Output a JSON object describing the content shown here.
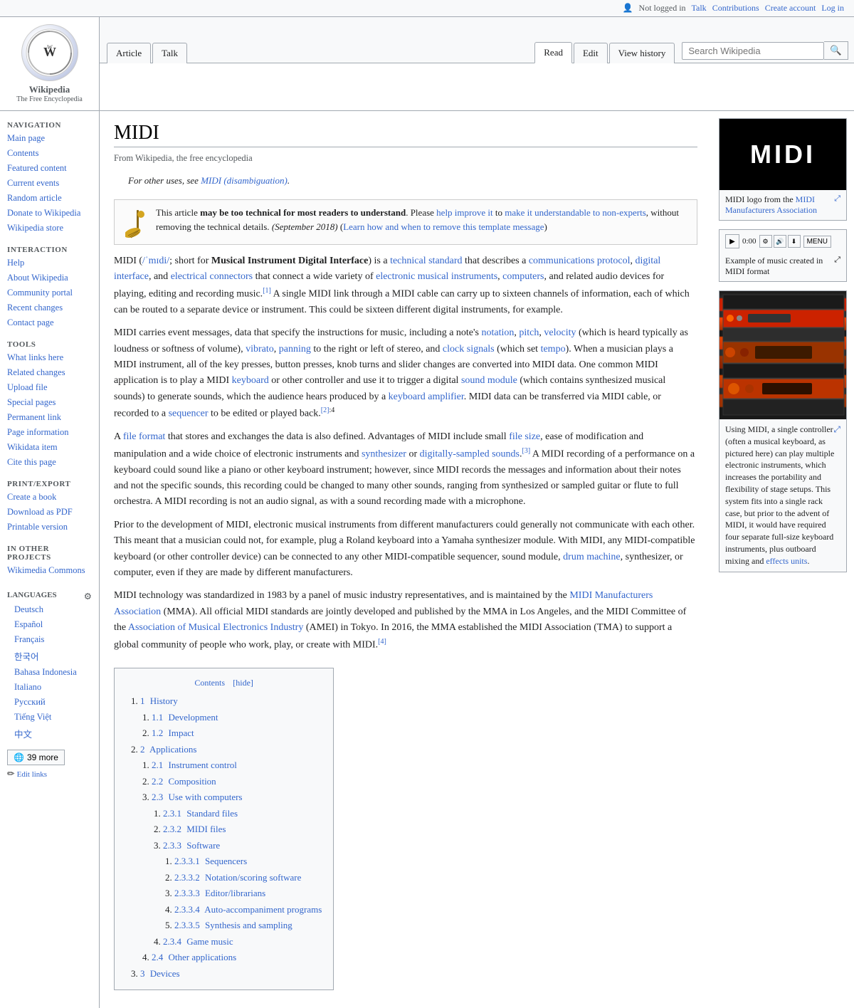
{
  "topbar": {
    "not_logged_in": "Not logged in",
    "talk": "Talk",
    "contributions": "Contributions",
    "create_account": "Create account",
    "log_in": "Log in"
  },
  "logo": {
    "title": "Wikipedia",
    "subtitle": "The Free Encyclopedia"
  },
  "tabs": [
    {
      "label": "Article",
      "id": "article",
      "active": false
    },
    {
      "label": "Talk",
      "id": "talk",
      "active": false
    },
    {
      "label": "Read",
      "id": "read",
      "active": true
    },
    {
      "label": "Edit",
      "id": "edit",
      "active": false
    },
    {
      "label": "View history",
      "id": "view-history",
      "active": false
    }
  ],
  "search": {
    "placeholder": "Search Wikipedia"
  },
  "sidebar": {
    "navigation_title": "Navigation",
    "nav_items": [
      {
        "label": "Main page",
        "id": "main-page"
      },
      {
        "label": "Contents",
        "id": "contents"
      },
      {
        "label": "Featured content",
        "id": "featured-content"
      },
      {
        "label": "Current events",
        "id": "current-events"
      },
      {
        "label": "Random article",
        "id": "random-article"
      },
      {
        "label": "Donate to Wikipedia",
        "id": "donate"
      },
      {
        "label": "Wikipedia store",
        "id": "store"
      }
    ],
    "interaction_title": "Interaction",
    "interaction_items": [
      {
        "label": "Help",
        "id": "help"
      },
      {
        "label": "About Wikipedia",
        "id": "about"
      },
      {
        "label": "Community portal",
        "id": "community-portal"
      },
      {
        "label": "Recent changes",
        "id": "recent-changes"
      },
      {
        "label": "Contact page",
        "id": "contact"
      }
    ],
    "tools_title": "Tools",
    "tools_items": [
      {
        "label": "What links here",
        "id": "what-links"
      },
      {
        "label": "Related changes",
        "id": "related-changes"
      },
      {
        "label": "Upload file",
        "id": "upload-file"
      },
      {
        "label": "Special pages",
        "id": "special-pages"
      },
      {
        "label": "Permanent link",
        "id": "permanent-link"
      },
      {
        "label": "Page information",
        "id": "page-info"
      },
      {
        "label": "Wikidata item",
        "id": "wikidata"
      },
      {
        "label": "Cite this page",
        "id": "cite"
      }
    ],
    "print_title": "Print/export",
    "print_items": [
      {
        "label": "Create a book",
        "id": "create-book"
      },
      {
        "label": "Download as PDF",
        "id": "download-pdf"
      },
      {
        "label": "Printable version",
        "id": "printable"
      }
    ],
    "other_title": "In other projects",
    "other_items": [
      {
        "label": "Wikimedia Commons",
        "id": "wikimedia-commons"
      }
    ],
    "languages_title": "Languages",
    "language_items": [
      {
        "label": "Deutsch",
        "id": "deutsch"
      },
      {
        "label": "Español",
        "id": "espanol"
      },
      {
        "label": "Français",
        "id": "francais"
      },
      {
        "label": "한국어",
        "id": "korean"
      },
      {
        "label": "Bahasa Indonesia",
        "id": "bahasa-indonesia"
      },
      {
        "label": "Italiano",
        "id": "italiano"
      },
      {
        "label": "Русский",
        "id": "russian"
      },
      {
        "label": "Tiếng Việt",
        "id": "tieng-viet"
      },
      {
        "label": "中文",
        "id": "chinese"
      }
    ],
    "more_languages": "39 more",
    "edit_links": "Edit links"
  },
  "page": {
    "title": "MIDI",
    "from_wiki": "From Wikipedia, the free encyclopedia",
    "hatnote": "For other uses, see MIDI (disambiguation).",
    "hatnote_link": "MIDI (disambiguation)",
    "ambox_text_bold": "This article may be too technical for most readers to understand.",
    "ambox_text": "Please help improve it to make it understandable to non-experts, without removing the technical details.",
    "ambox_date": "(September 2018)",
    "ambox_link_text": "help improve it",
    "ambox_link2_text": "make it understandable to non-experts",
    "ambox_link3_text": "Learn how and when to remove this template message"
  },
  "article": {
    "intro_p1": "MIDI (/ˈmɪdi/; short for Musical Instrument Digital Interface) is a technical standard that describes a communications protocol, digital interface, and electrical connectors that connect a wide variety of electronic musical instruments, computers, and related audio devices for playing, editing and recording music.[1] A single MIDI link through a MIDI cable can carry up to sixteen channels of information, each of which can be routed to a separate device or instrument. This could be sixteen different digital instruments, for example.",
    "intro_p2": "MIDI carries event messages, data that specify the instructions for music, including a note's notation, pitch, velocity (which is heard typically as loudness or softness of volume), vibrato, panning to the right or left of stereo, and clock signals (which set tempo). When a musician plays a MIDI instrument, all of the key presses, button presses, knob turns and slider changes are converted into MIDI data. One common MIDI application is to play a MIDI keyboard or other controller and use it to trigger a digital sound module (which contains synthesized musical sounds) to generate sounds, which the audience hears produced by a keyboard amplifier. MIDI data can be transferred via MIDI cable, or recorded to a sequencer to be edited or played back.[2]:4",
    "intro_p3": "A file format that stores and exchanges the data is also defined. Advantages of MIDI include small file size, ease of modification and manipulation and a wide choice of electronic instruments and synthesizer or digitally-sampled sounds.[3] A MIDI recording of a performance on a keyboard could sound like a piano or other keyboard instrument; however, since MIDI records the messages and information about their notes and not the specific sounds, this recording could be changed to many other sounds, ranging from synthesized or sampled guitar or flute to full orchestra. A MIDI recording is not an audio signal, as with a sound recording made with a microphone.",
    "intro_p4": "Prior to the development of MIDI, electronic musical instruments from different manufacturers could generally not communicate with each other. This meant that a musician could not, for example, plug a Roland keyboard into a Yamaha synthesizer module. With MIDI, any MIDI-compatible keyboard (or other controller device) can be connected to any other MIDI-compatible sequencer, sound module, drum machine, synthesizer, or computer, even if they are made by different manufacturers.",
    "intro_p5": "MIDI technology was standardized in 1983 by a panel of music industry representatives, and is maintained by the MIDI Manufacturers Association (MMA). All official MIDI standards are jointly developed and published by the MMA in Los Angeles, and the MIDI Committee of the Association of Musical Electronics Industry (AMEI) in Tokyo. In 2016, the MMA established the MIDI Association (TMA) to support a global community of people who work, play, or create with MIDI.[4]"
  },
  "toc": {
    "title": "Contents",
    "hide_label": "hide",
    "items": [
      {
        "num": "1",
        "label": "History",
        "id": "History"
      },
      {
        "num": "1.1",
        "label": "Development",
        "id": "Development",
        "sub": true
      },
      {
        "num": "1.2",
        "label": "Impact",
        "id": "Impact",
        "sub": true
      },
      {
        "num": "2",
        "label": "Applications",
        "id": "Applications"
      },
      {
        "num": "2.1",
        "label": "Instrument control",
        "id": "Instrument_control",
        "sub": true
      },
      {
        "num": "2.2",
        "label": "Composition",
        "id": "Composition",
        "sub": true
      },
      {
        "num": "2.3",
        "label": "Use with computers",
        "id": "Use_with_computers",
        "sub": true
      },
      {
        "num": "2.3.1",
        "label": "Standard files",
        "id": "Standard_files",
        "sub2": true
      },
      {
        "num": "2.3.2",
        "label": "MIDI files",
        "id": "MIDI_files",
        "sub2": true
      },
      {
        "num": "2.3.3",
        "label": "Software",
        "id": "Software",
        "sub2": true
      },
      {
        "num": "2.3.3.1",
        "label": "Sequencers",
        "id": "Sequencers",
        "sub3": true
      },
      {
        "num": "2.3.3.2",
        "label": "Notation/scoring software",
        "id": "Notation_scoring_software",
        "sub3": true
      },
      {
        "num": "2.3.3.3",
        "label": "Editor/librarians",
        "id": "Editor_librarians",
        "sub3": true
      },
      {
        "num": "2.3.3.4",
        "label": "Auto-accompaniment programs",
        "id": "Auto_accompaniment",
        "sub3": true
      },
      {
        "num": "2.3.3.5",
        "label": "Synthesis and sampling",
        "id": "Synthesis_sampling",
        "sub3": true
      },
      {
        "num": "2.3.4",
        "label": "Game music",
        "id": "Game_music",
        "sub2": true
      },
      {
        "num": "2.4",
        "label": "Other applications",
        "id": "Other_applications",
        "sub": true
      },
      {
        "num": "3",
        "label": "Devices",
        "id": "Devices"
      }
    ]
  },
  "infobox1": {
    "logo_text": "MIDI",
    "caption": "MIDI logo from the MIDI Manufacturers Association",
    "expand_title": "expand"
  },
  "audio_box": {
    "time": "0:00",
    "menu_label": "MENU",
    "caption": "Example of music created in MIDI format",
    "expand_title": "expand"
  },
  "photo_box": {
    "caption": "Using MIDI, a single controller (often a musical keyboard, as pictured here) can play multiple electronic instruments, which increases the portability and flexibility of stage setups. This system fits into a single rack case, but prior to the advent of MIDI, it would have required four separate full-size keyboard instruments, plus outboard mixing and effects units.",
    "effects_link": "effects units"
  }
}
